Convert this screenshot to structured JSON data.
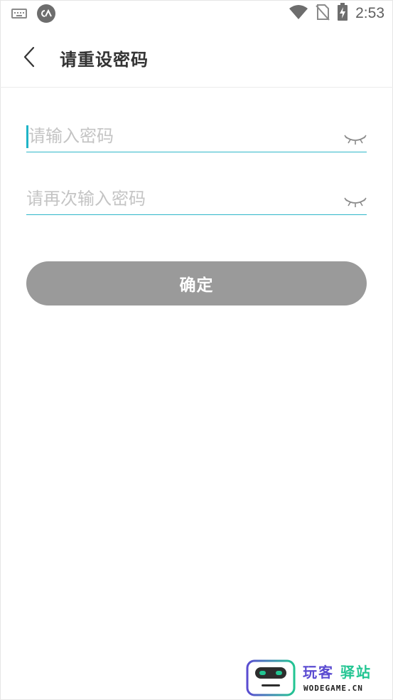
{
  "status_bar": {
    "time": "2:53",
    "icons": [
      "keyboard-icon",
      "app-icon",
      "wifi-icon",
      "no-sim-icon",
      "battery-charging-icon"
    ]
  },
  "header": {
    "back_icon": "chevron-left-icon",
    "title": "请重设密码"
  },
  "form": {
    "password_placeholder": "请输入密码",
    "confirm_placeholder": "请再次输入密码",
    "toggle_icon": "eye-closed-icon",
    "submit_label": "确定"
  },
  "watermark": {
    "cn_part1": "玩客",
    "cn_part2": "驿站",
    "en": "WODEGAME.CN"
  },
  "colors": {
    "accent": "#30b7c9",
    "button_disabled": "#9a9a9a",
    "placeholder": "#c4c4c4",
    "title": "#333333"
  }
}
